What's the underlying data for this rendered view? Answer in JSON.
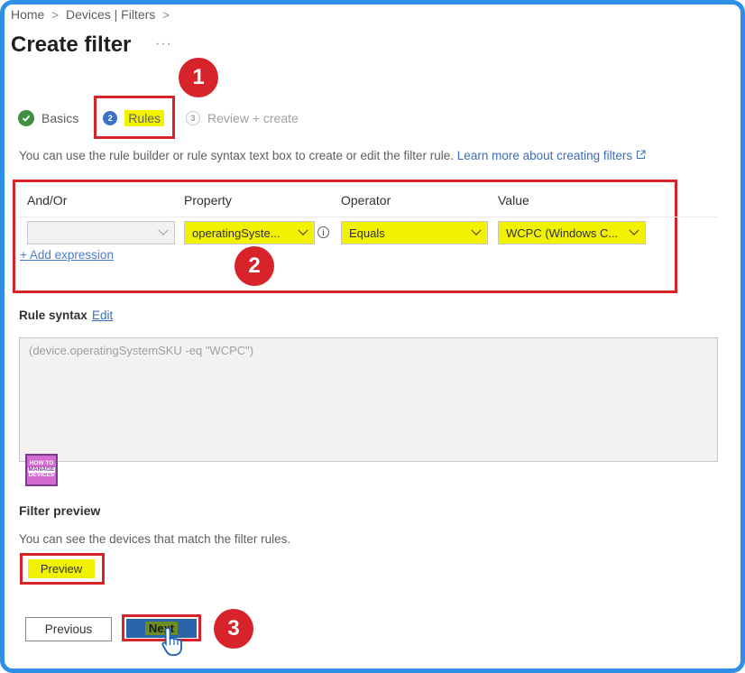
{
  "breadcrumb": {
    "items": [
      "Home",
      "Devices | Filters"
    ]
  },
  "page": {
    "title": "Create filter",
    "more": "···"
  },
  "wizard": {
    "steps": [
      {
        "num": "",
        "label": "Basics",
        "state": "complete"
      },
      {
        "num": "2",
        "label": "Rules",
        "state": "current"
      },
      {
        "num": "3",
        "label": "Review + create",
        "state": "disabled"
      }
    ]
  },
  "description": {
    "text": "You can use the rule builder or rule syntax text box to create or edit the filter rule.",
    "link": "Learn more about creating filters"
  },
  "builder": {
    "headers": {
      "andor": "And/Or",
      "property": "Property",
      "operator": "Operator",
      "value": "Value"
    },
    "row": {
      "andor": "",
      "property": "operatingSyste...",
      "operator": "Equals",
      "value": "WCPC (Windows C..."
    },
    "add_expression": "+ Add expression"
  },
  "rule_syntax": {
    "label": "Rule syntax",
    "edit": "Edit",
    "value": "(device.operatingSystemSKU -eq \"WCPC\")"
  },
  "logo": {
    "line1": "HOW TO",
    "line2": "MANAGE",
    "line3": "DEVICES"
  },
  "filter_preview": {
    "title": "Filter preview",
    "text": "You can see the devices that match the filter rules.",
    "button": "Preview"
  },
  "footer": {
    "previous": "Previous",
    "next": "Next"
  },
  "callouts": [
    "1",
    "2",
    "3"
  ],
  "colors": {
    "highlight": "#f2f200",
    "callout": "#d6242a",
    "frame": "#2f8fe6",
    "primary": "#2c64ac"
  }
}
